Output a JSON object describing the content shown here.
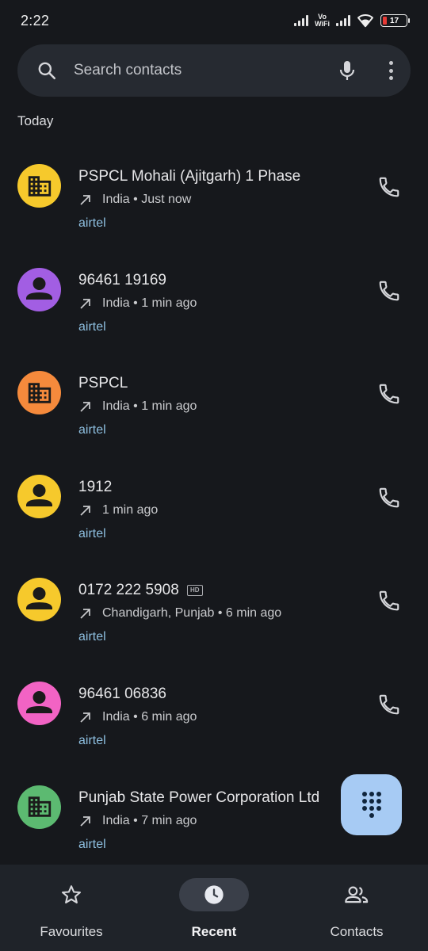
{
  "status_bar": {
    "time": "2:22",
    "network_label_1": "Vo",
    "network_label_2": "WiFi",
    "battery": "17"
  },
  "search": {
    "placeholder": "Search contacts"
  },
  "section_today": "Today",
  "calls": [
    {
      "name": "PSPCL Mohali (Ajitgarh) 1 Phase",
      "detail": "India • Just now",
      "carrier": "airtel",
      "avatar": "business-icon",
      "avatar_color": "#f6c92c",
      "hd": false
    },
    {
      "name": "96461 19169",
      "detail": "India • 1 min ago",
      "carrier": "airtel",
      "avatar": "person-icon",
      "avatar_color": "#a25ee3",
      "hd": false
    },
    {
      "name": "PSPCL",
      "detail": "India • 1 min ago",
      "carrier": "airtel",
      "avatar": "business-icon",
      "avatar_color": "#f58a3c",
      "hd": false
    },
    {
      "name": "1912",
      "detail": "1 min ago",
      "carrier": "airtel",
      "avatar": "person-icon",
      "avatar_color": "#f6c92c",
      "hd": false
    },
    {
      "name": "0172 222 5908",
      "detail": "Chandigarh, Punjab • 6 min ago",
      "carrier": "airtel",
      "avatar": "person-icon",
      "avatar_color": "#f6c92c",
      "hd": true,
      "hd_label": "HD"
    },
    {
      "name": "96461 06836",
      "detail": "India • 6 min ago",
      "carrier": "airtel",
      "avatar": "person-icon",
      "avatar_color": "#f263c4",
      "hd": false
    },
    {
      "name": "Punjab State Power Corporation Ltd",
      "detail": "India • 7 min ago",
      "carrier": "airtel",
      "avatar": "business-icon",
      "avatar_color": "#5cba71",
      "hd": false
    }
  ],
  "fab": {
    "icon": "dialpad-icon"
  },
  "nav": {
    "favourites": "Favourites",
    "recent": "Recent",
    "contacts": "Contacts"
  }
}
